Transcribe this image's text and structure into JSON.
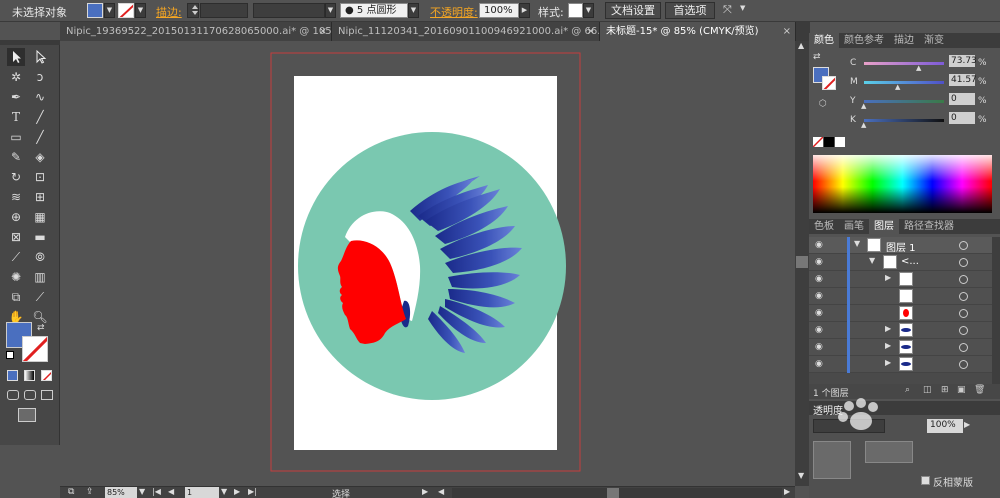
{
  "control_bar": {
    "selection_label": "未选择对象",
    "stroke_label": "描边:",
    "brush_label": "5 点圆形",
    "opacity_label": "不透明度:",
    "opacity_value": "100%",
    "style_label": "样式:",
    "doc_setup_button": "文档设置",
    "prefs_button": "首选项"
  },
  "tabs": [
    {
      "label": "Nipic_19369522_20150131170628065000.ai* @ 105...",
      "close": "×"
    },
    {
      "label": "Nipic_11120341_20160901100946921000.ai* @ 66.6...",
      "close": "×"
    },
    {
      "label": "未标题-15* @ 85% (CMYK/预览)",
      "close": "×"
    }
  ],
  "colors": {
    "fill": "#4a6fbf",
    "teal_circle": "#7ac8b0",
    "feather_dark": "#1a2a8a",
    "feather_light": "#4a64c8",
    "headband": "#ffffff",
    "face": "#ff0000",
    "artboard_border": "#c43c3c",
    "layer_bar": "#4a7bd6"
  },
  "color_panel": {
    "tabs": [
      "颜色",
      "颜色参考",
      "描边",
      "渐变"
    ],
    "sliders": [
      {
        "letter": "C",
        "value": "73.73",
        "unit": "%",
        "fraction": 0.7373
      },
      {
        "letter": "M",
        "value": "41.57",
        "unit": "%",
        "fraction": 0.4157
      },
      {
        "letter": "Y",
        "value": "0",
        "unit": "%",
        "fraction": 0
      },
      {
        "letter": "K",
        "value": "0",
        "unit": "%",
        "fraction": 0
      }
    ]
  },
  "layers_panel": {
    "tabs": [
      "色板",
      "画笔",
      "图层",
      "路径查找器"
    ],
    "layer_name": "图层 1",
    "group_name": "<...",
    "footer_count": "1 个图层"
  },
  "transparency_panel": {
    "title": "透明度",
    "opacity_value": "100%",
    "invert_mask_label": "反相蒙版"
  },
  "status_bar": {
    "zoom": "85%",
    "page": "1",
    "tool_name": "选择"
  },
  "watermark": "Baidu 经验"
}
